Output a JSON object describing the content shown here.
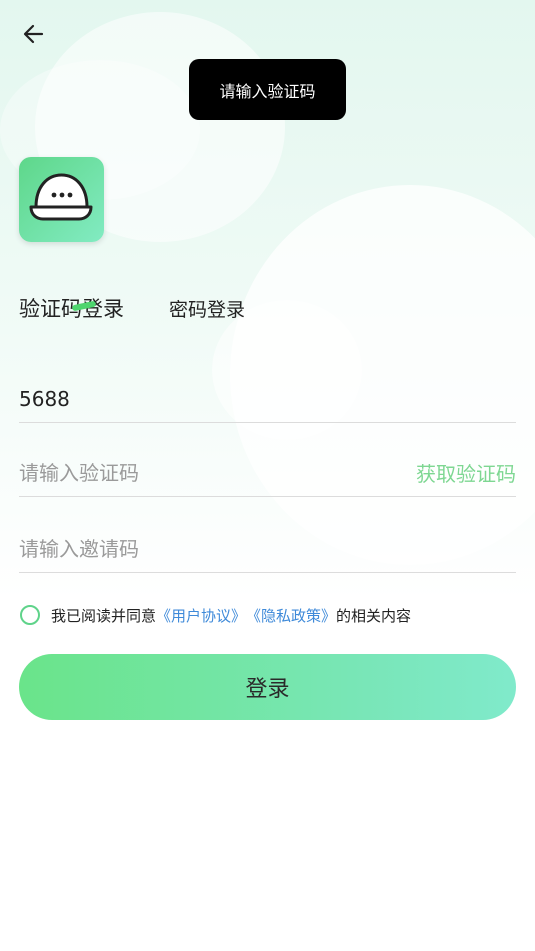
{
  "toast": {
    "message": "请输入验证码"
  },
  "tabs": [
    {
      "label": "验证码登录",
      "active": true
    },
    {
      "label": "密码登录",
      "active": false
    }
  ],
  "form": {
    "phone_value": "5688",
    "code_placeholder": "请输入验证码",
    "get_code_label": "获取验证码",
    "invite_placeholder": "请输入邀请码"
  },
  "agreement": {
    "prefix": "我已阅读并同意",
    "user_agreement": "《用户协议》",
    "privacy_policy": "《隐私政策》",
    "suffix": "的相关内容"
  },
  "login_button": {
    "label": "登录"
  },
  "colors": {
    "accent": "#6ae48a",
    "link": "#3f8ad9",
    "get_code": "#7ed792"
  },
  "icons": {
    "back": "arrow-left-icon",
    "logo": "helmet-logo-icon"
  }
}
